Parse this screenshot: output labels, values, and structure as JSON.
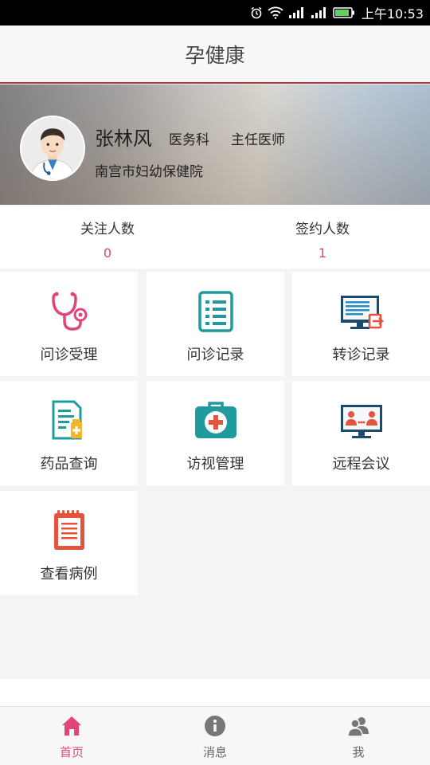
{
  "status_bar": {
    "time": "上午10:53"
  },
  "header": {
    "title": "孕健康"
  },
  "profile": {
    "name": "张林风",
    "department": "医务科",
    "title": "主任医师",
    "hospital": "南宫市妇幼保健院"
  },
  "stats": [
    {
      "label": "关注人数",
      "value": "0"
    },
    {
      "label": "签约人数",
      "value": "1"
    }
  ],
  "menu": [
    {
      "label": "问诊受理",
      "icon": "stethoscope-icon"
    },
    {
      "label": "问诊记录",
      "icon": "list-document-icon"
    },
    {
      "label": "转诊记录",
      "icon": "monitor-transfer-icon"
    },
    {
      "label": "药品查询",
      "icon": "medicine-document-icon"
    },
    {
      "label": "访视管理",
      "icon": "first-aid-kit-icon"
    },
    {
      "label": "远程会议",
      "icon": "video-conference-icon"
    },
    {
      "label": "查看病例",
      "icon": "notepad-icon"
    }
  ],
  "tabs": [
    {
      "label": "首页",
      "icon": "home-icon",
      "active": true
    },
    {
      "label": "消息",
      "icon": "info-icon",
      "active": false
    },
    {
      "label": "我",
      "icon": "users-icon",
      "active": false
    }
  ],
  "colors": {
    "accent": "#e0457b",
    "header_border": "#b8343c",
    "teal": "#1f9b9f",
    "red": "#e4543c",
    "navy": "#1e4a6e"
  }
}
